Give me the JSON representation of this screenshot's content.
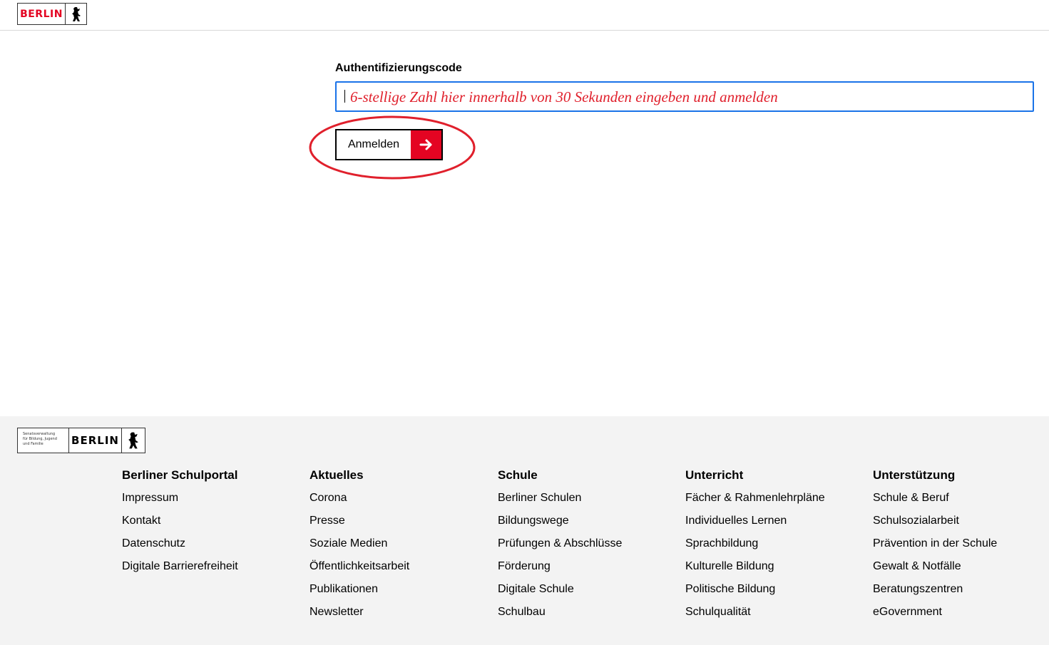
{
  "header": {
    "logo_text": "BERLIN"
  },
  "form": {
    "label": "Authentifizierungscode",
    "input_value": "",
    "annotation": "6-stellige Zahl hier innerhalb von 30 Sekunden eingeben und anmelden",
    "submit_label": "Anmelden",
    "annotation_color": "#e0202c",
    "accent_color": "#e40422",
    "focus_color": "#1a73e8"
  },
  "footer": {
    "logo_senat_lines": [
      "Senatsverwaltung",
      "für Bildung, Jugend",
      "und Familie"
    ],
    "logo_text": "BERLIN",
    "columns": [
      {
        "title": "Berliner Schulportal",
        "links": [
          "Impressum",
          "Kontakt",
          "Datenschutz",
          "Digitale Barrierefreiheit"
        ]
      },
      {
        "title": "Aktuelles",
        "links": [
          "Corona",
          "Presse",
          "Soziale Medien",
          "Öffentlichkeitsarbeit",
          "Publikationen",
          "Newsletter"
        ]
      },
      {
        "title": "Schule",
        "links": [
          "Berliner Schulen",
          "Bildungswege",
          "Prüfungen & Abschlüsse",
          "Förderung",
          "Digitale Schule",
          "Schulbau"
        ]
      },
      {
        "title": "Unterricht",
        "links": [
          "Fächer & Rahmenlehrpläne",
          "Individuelles Lernen",
          "Sprachbildung",
          "Kulturelle Bildung",
          "Politische Bildung",
          "Schulqualität"
        ]
      },
      {
        "title": "Unterstützung",
        "links": [
          "Schule & Beruf",
          "Schulsozialarbeit",
          "Prävention in der Schule",
          "Gewalt & Notfälle",
          "Beratungszentren",
          "eGovernment"
        ]
      }
    ]
  }
}
